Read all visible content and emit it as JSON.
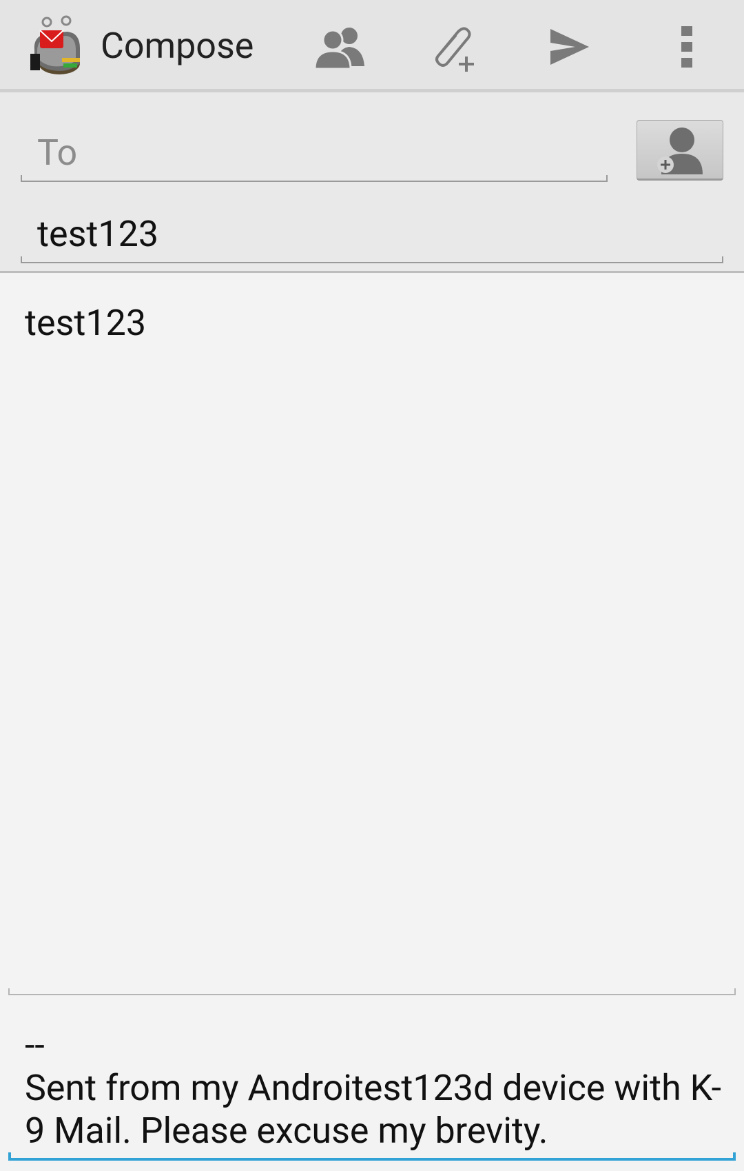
{
  "actionbar": {
    "title": "Compose",
    "icons": [
      "k9-app-icon",
      "contacts-icon",
      "attach-icon",
      "send-icon",
      "overflow-menu-icon"
    ]
  },
  "header": {
    "to_placeholder": "To",
    "to_value": "",
    "subject_value": "test123"
  },
  "message": {
    "body": "test123",
    "signature": "--\nSent from my Androitest123d device with K-9 Mail. Please excuse my brevity."
  },
  "colors": {
    "accent_underline": "#33a3d6",
    "actionbar_bg": "#e4e4e4",
    "icon_gray": "#7a7a7a"
  }
}
